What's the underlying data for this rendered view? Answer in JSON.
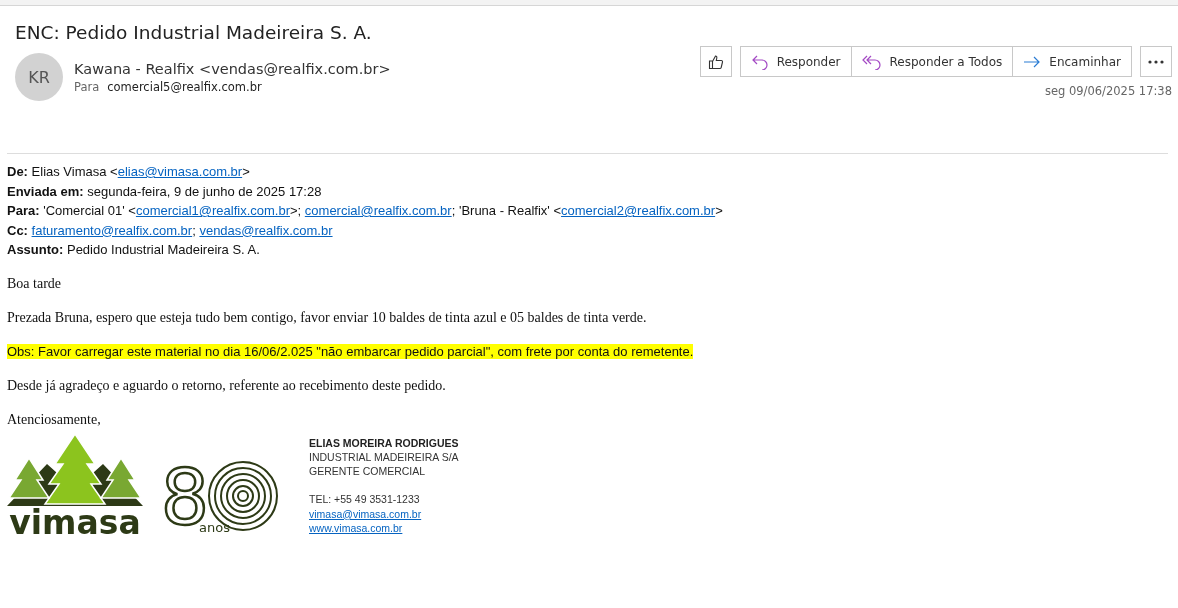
{
  "message": {
    "subject": "ENC: Pedido Industrial Madeireira S. A.",
    "avatar_initials": "KR",
    "sender": "Kawana - Realfix <vendas@realfix.com.br>",
    "to_label": "Para",
    "to": "comercial5@realfix.com.br",
    "actions": [
      {
        "kind": "like"
      },
      {
        "kind": "reply",
        "label": "Responder"
      },
      {
        "kind": "reply-all",
        "label": "Responder a Todos"
      },
      {
        "kind": "forward",
        "label": "Encaminhar"
      },
      {
        "kind": "more"
      }
    ],
    "date": "seg 09/06/2025 17:38"
  },
  "forwarded_header": [
    {
      "label": "De:",
      "parts": [
        {
          "kind": "text",
          "text": "Elias Vimasa <"
        },
        {
          "kind": "link",
          "text": "elias@vimasa.com.br"
        },
        {
          "kind": "text",
          "text": ">"
        }
      ]
    },
    {
      "label": "Enviada em:",
      "parts": [
        {
          "kind": "text",
          "text": "segunda-feira, 9 de junho de 2025 17:28"
        }
      ]
    },
    {
      "label": "Para:",
      "parts": [
        {
          "kind": "text",
          "text": "'Comercial 01' <"
        },
        {
          "kind": "link",
          "text": "comercial1@realfix.com.br"
        },
        {
          "kind": "text",
          "text": ">; "
        },
        {
          "kind": "link",
          "text": "comercial@realfix.com.br"
        },
        {
          "kind": "text",
          "text": "; 'Bruna - Realfix' <"
        },
        {
          "kind": "link",
          "text": "comercial2@realfix.com.br"
        },
        {
          "kind": "text",
          "text": ">"
        }
      ]
    },
    {
      "label": "Cc:",
      "parts": [
        {
          "kind": "link",
          "text": "faturamento@realfix.com.br"
        },
        {
          "kind": "text",
          "text": "; "
        },
        {
          "kind": "link",
          "text": "vendas@realfix.com.br"
        }
      ]
    },
    {
      "label": "Assunto:",
      "parts": [
        {
          "kind": "text",
          "text": "Pedido Industrial Madeireira S. A."
        }
      ]
    }
  ],
  "body": [
    {
      "text": "Boa tarde",
      "highlighted": false
    },
    {
      "text": "Prezada Bruna, espero que esteja tudo bem contigo, favor enviar 10 baldes de tinta azul e 05 baldes de tinta verde.",
      "highlighted": false
    },
    {
      "text": "Obs: Favor carregar este material no dia 16/06/2.025 \"não embarcar pedido parcial\", com frete por conta do remetente.",
      "highlighted": true
    },
    {
      "text": "Desde já agradeço e aguardo o retorno, referente ao recebimento deste pedido.",
      "highlighted": false
    },
    {
      "text": "Atenciosamente,",
      "highlighted": false
    }
  ],
  "signature": {
    "logo_word": "vimasa",
    "anniversary_digit": "8",
    "anniversary_word": "anos",
    "lines": [
      {
        "kind": "name",
        "text": "ELIAS MOREIRA RODRIGUES"
      },
      {
        "kind": "text",
        "text": "INDUSTRIAL MADEIREIRA S/A"
      },
      {
        "kind": "text",
        "text": "GERENTE COMERCIAL"
      },
      {
        "kind": "gap"
      },
      {
        "kind": "text",
        "text": "TEL: +55 49 3531-1233"
      },
      {
        "kind": "link",
        "text": "vimasa@vimasa.com.br"
      },
      {
        "kind": "link",
        "text": "www.vimasa.com.br"
      }
    ]
  }
}
